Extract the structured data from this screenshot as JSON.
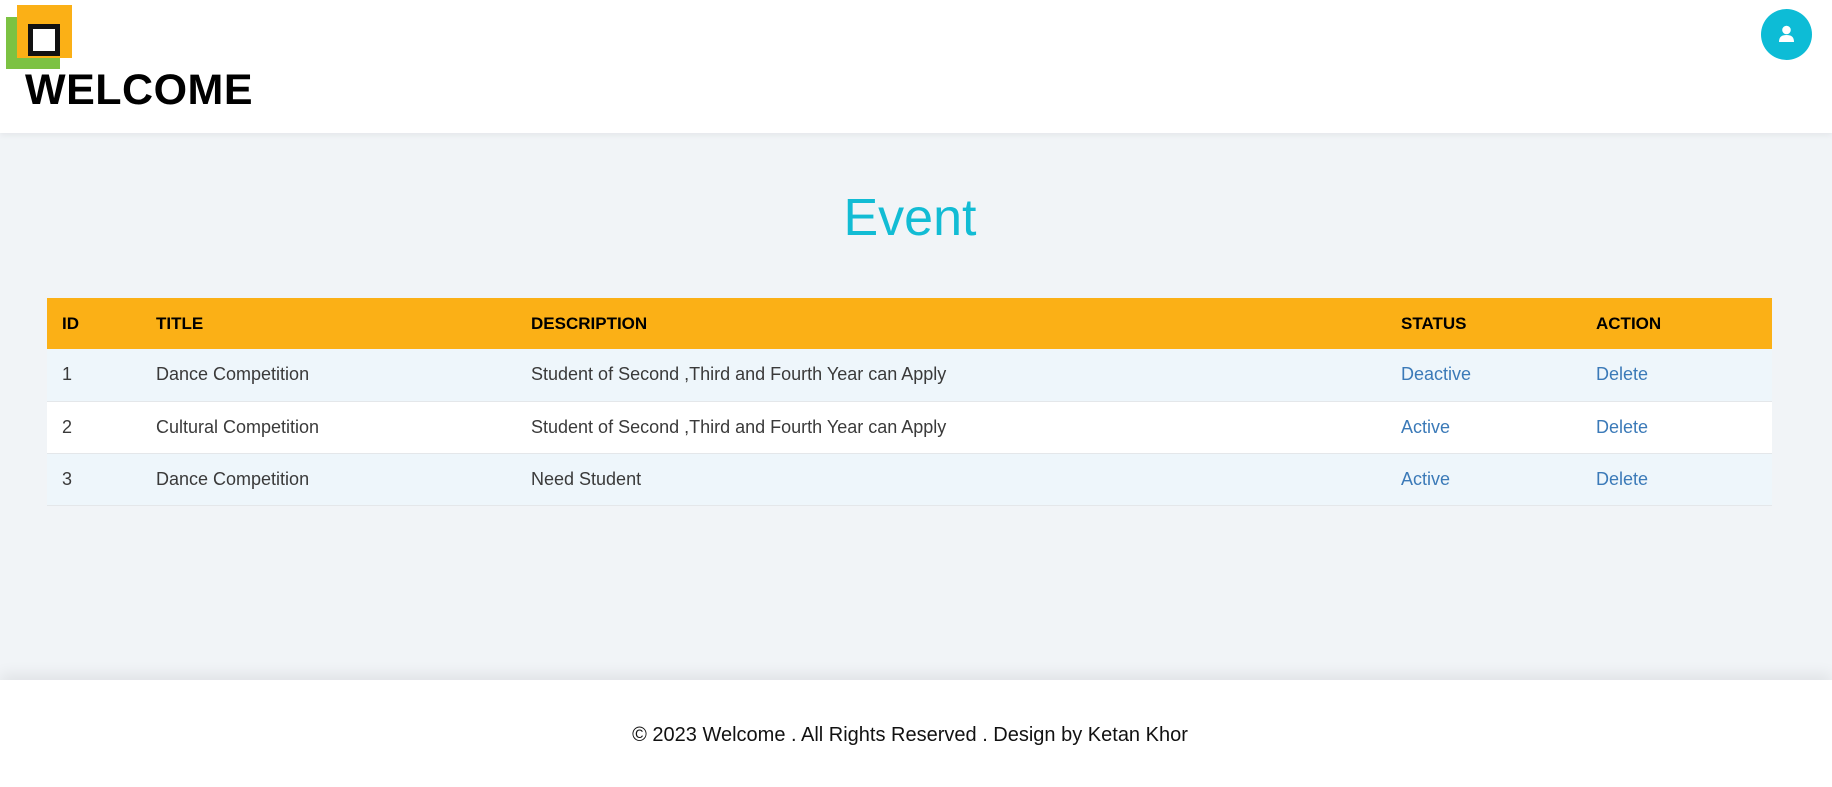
{
  "header": {
    "brand": "WELCOME",
    "logo_icon": "logo-squares-icon",
    "profile_icon": "user-icon"
  },
  "page": {
    "title": "Event"
  },
  "table": {
    "columns": [
      "ID",
      "TITLE",
      "DESCRIPTION",
      "STATUS",
      "ACTION"
    ],
    "rows": [
      {
        "id": "1",
        "title": "Dance Competition",
        "description": "Student of Second ,Third and Fourth Year can Apply",
        "status": "Deactive",
        "action": "Delete"
      },
      {
        "id": "2",
        "title": "Cultural Competition",
        "description": "Student of Second ,Third and Fourth Year can Apply",
        "status": "Active",
        "action": "Delete"
      },
      {
        "id": "3",
        "title": "Dance Competition",
        "description": "Need Student",
        "status": "Active",
        "action": "Delete"
      }
    ]
  },
  "footer": {
    "text": "© 2023 Welcome . All Rights Reserved . Design by Ketan Khor"
  },
  "colors": {
    "accent": "#12bcd4",
    "table_header": "#fbb016",
    "link": "#3b7ab8",
    "logo_green": "#7cc242"
  }
}
